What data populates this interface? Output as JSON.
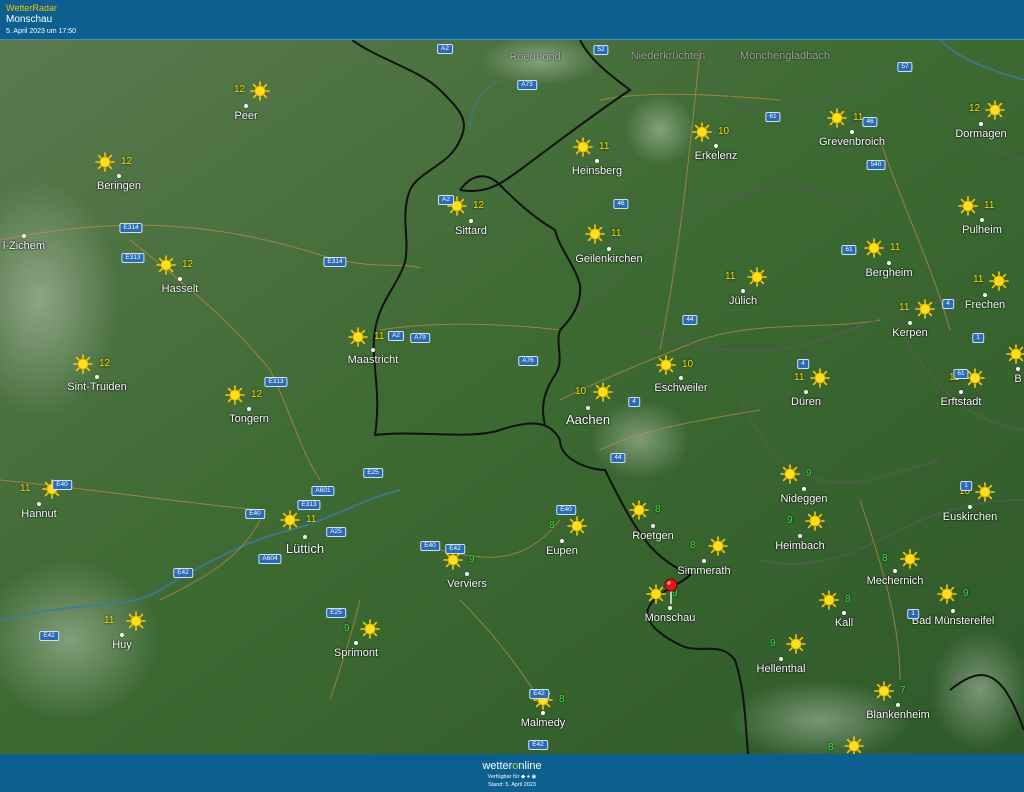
{
  "header": {
    "brand": "WetterRadar",
    "location": "Monschau",
    "timestamp": "5. April 2023 um 17:50"
  },
  "footer": {
    "logo_pre": "wetter",
    "logo_o": "o",
    "logo_post": "nline",
    "available": "Verfügbar für",
    "stand": "Stand: 5. April 2023"
  },
  "cities": [
    {
      "name": "Roermond",
      "dim": true
    },
    {
      "name": "Niederkrüchten",
      "dim": true
    },
    {
      "name": "Mönchengladbach",
      "dim": true
    },
    {
      "name": "Peer",
      "temp": "12",
      "c": "y"
    },
    {
      "name": "Beringen",
      "temp": "12",
      "c": "y"
    },
    {
      "name": "Hasselt",
      "temp": "12",
      "c": "y"
    },
    {
      "name": "Sint-Truiden",
      "temp": "12",
      "c": "y"
    },
    {
      "name": "Tongern",
      "temp": "12",
      "c": "y"
    },
    {
      "name": "Hannut",
      "temp": "11",
      "c": "y"
    },
    {
      "name": "Huy",
      "temp": "11",
      "c": "y"
    },
    {
      "name": "Lüttich",
      "temp": "11",
      "c": "y",
      "big": true
    },
    {
      "name": "Maastricht",
      "temp": "11",
      "c": "y"
    },
    {
      "name": "Sittard",
      "temp": "12",
      "c": "y"
    },
    {
      "name": "Heinsberg",
      "temp": "11",
      "c": "y"
    },
    {
      "name": "Erkelenz",
      "temp": "10",
      "c": "y"
    },
    {
      "name": "Grevenbroich",
      "temp": "11",
      "c": "y"
    },
    {
      "name": "Dormagen",
      "temp": "12",
      "c": "y"
    },
    {
      "name": "Geilenkirchen",
      "temp": "11",
      "c": "y"
    },
    {
      "name": "Pulheim",
      "temp": "11",
      "c": "y"
    },
    {
      "name": "Bergheim",
      "temp": "11",
      "c": "y"
    },
    {
      "name": "Jülich",
      "temp": "11",
      "c": "y"
    },
    {
      "name": "Frechen",
      "temp": "11",
      "c": "y"
    },
    {
      "name": "Kerpen",
      "temp": "11",
      "c": "y"
    },
    {
      "name": "Eschweiler",
      "temp": "10",
      "c": "y"
    },
    {
      "name": "Aachen",
      "temp": "10",
      "c": "y",
      "big": true
    },
    {
      "name": "Düren",
      "temp": "11",
      "c": "y"
    },
    {
      "name": "Erftstadt",
      "temp": "11",
      "c": "y"
    },
    {
      "name": "Verviers",
      "temp": "9",
      "c": "g"
    },
    {
      "name": "Eupen",
      "temp": "8",
      "c": "g"
    },
    {
      "name": "Roetgen",
      "temp": "8",
      "c": "g"
    },
    {
      "name": "Nideggen",
      "temp": "9",
      "c": "g"
    },
    {
      "name": "Heimbach",
      "temp": "9",
      "c": "g"
    },
    {
      "name": "Euskirchen",
      "temp": "10",
      "c": "y"
    },
    {
      "name": "Simmerath",
      "temp": "8",
      "c": "g"
    },
    {
      "name": "Mechernich",
      "temp": "8",
      "c": "g"
    },
    {
      "name": "Monschau",
      "temp": "9",
      "c": "g"
    },
    {
      "name": "Kall",
      "temp": "8",
      "c": "g"
    },
    {
      "name": "Bad Münstereifel",
      "temp": "9",
      "c": "g"
    },
    {
      "name": "Sprimont",
      "temp": "9",
      "c": "g"
    },
    {
      "name": "Hellenthal",
      "temp": "9",
      "c": "g"
    },
    {
      "name": "Malmedy",
      "temp": "8",
      "c": "g"
    },
    {
      "name": "Blankenheim",
      "temp": "7",
      "c": "g"
    },
    {
      "name": "l-Zichem"
    },
    {
      "name": "B"
    }
  ],
  "extra_temps": [
    {
      "temp": "8",
      "c": "g"
    }
  ],
  "roads": [
    "A2",
    "52",
    "57",
    "A73",
    "61",
    "46",
    "540",
    "46",
    "E314",
    "E313",
    "E314",
    "A2",
    "61",
    "A79",
    "A2",
    "4",
    "1",
    "44",
    "A76",
    "4",
    "E313",
    "4",
    "61",
    "1",
    "44",
    "E25",
    "E40",
    "A601",
    "E313",
    "E40",
    "A25",
    "E40",
    "E42",
    "A604",
    "E42",
    "E25",
    "E42",
    "E42",
    "1",
    "E42",
    "E40"
  ]
}
